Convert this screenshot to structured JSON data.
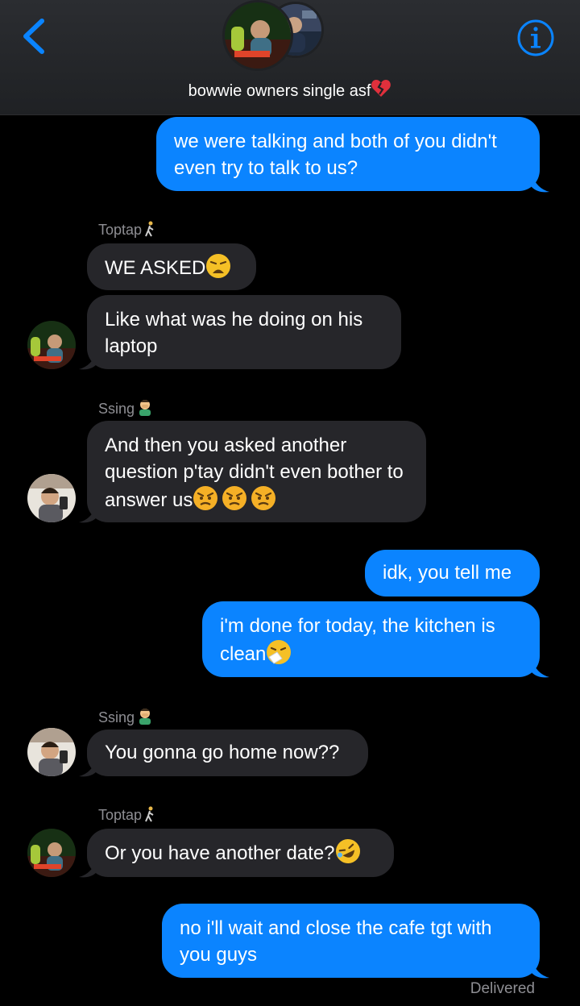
{
  "header": {
    "group_name": "bowwie owners single asf",
    "group_name_emoji": "broken-heart-emoji"
  },
  "messages": [
    {
      "dir": "out",
      "text": "we were talking and both of you didn't even try to talk to us?"
    },
    {
      "dir": "in",
      "sender": "Toptap",
      "sender_emoji": "person-walking-emoji",
      "text": "WE ASKED",
      "emoji": "weary-face-emoji"
    },
    {
      "dir": "in",
      "text": "Like what was he doing on his laptop"
    },
    {
      "dir": "in",
      "sender": "Ssing",
      "sender_emoji": "person-facepalming-emoji",
      "text": "And then you asked another question p'tay didn't even bother to answer us",
      "emoji": "angry-face-emoji x3"
    },
    {
      "dir": "out",
      "text": "idk, you tell me"
    },
    {
      "dir": "out",
      "text": "i'm done for today, the kitchen is clean",
      "emoji": "sneezing-face-emoji"
    },
    {
      "dir": "in",
      "sender": "Ssing",
      "sender_emoji": "person-facepalming-emoji",
      "text": "You gonna go home now??"
    },
    {
      "dir": "in",
      "sender": "Toptap",
      "sender_emoji": "person-walking-emoji",
      "text": "Or you have another date?",
      "emoji": "rolling-on-floor-laughing-emoji"
    },
    {
      "dir": "out",
      "text": "no i'll wait and close the cafe tgt with you guys"
    }
  ],
  "status": {
    "delivered": "Delivered"
  },
  "colors": {
    "outgoing": "#0b84ff",
    "incoming": "#26262a",
    "accent": "#0a84ff",
    "background": "#000000"
  }
}
